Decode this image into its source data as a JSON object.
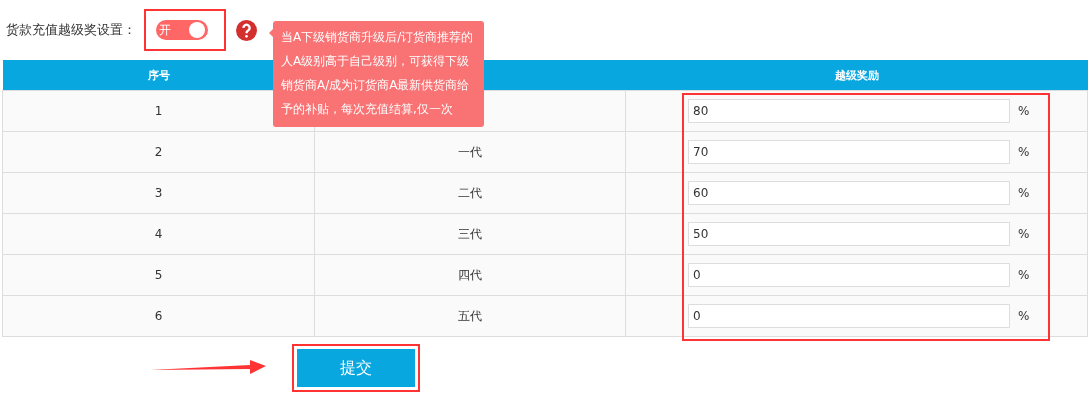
{
  "setting": {
    "label": "货款充值越级奖设置：",
    "toggle": {
      "label": "开",
      "on": true
    }
  },
  "tooltip": {
    "text": "当A下级销货商升级后/订货商推荐的人A级别高于自己级别，可获得下级销货商A/成为订货商A最新供货商给予的补贴，每次充值结算,仅一次"
  },
  "table": {
    "column_1": "序号",
    "column_3": "越级奖励",
    "rows": [
      {
        "index": "1",
        "reward": "80",
        "unit": "%"
      },
      {
        "index": "2",
        "generation": "一代",
        "reward": "70",
        "unit": "%"
      },
      {
        "index": "3",
        "generation": "二代",
        "reward": "60",
        "unit": "%"
      },
      {
        "index": "4",
        "generation": "三代",
        "reward": "50",
        "unit": "%"
      },
      {
        "index": "5",
        "generation": "四代",
        "reward": "0",
        "unit": "%"
      },
      {
        "index": "6",
        "generation": "五代",
        "reward": "0",
        "unit": "%"
      }
    ]
  },
  "submit": {
    "label": "提交"
  }
}
